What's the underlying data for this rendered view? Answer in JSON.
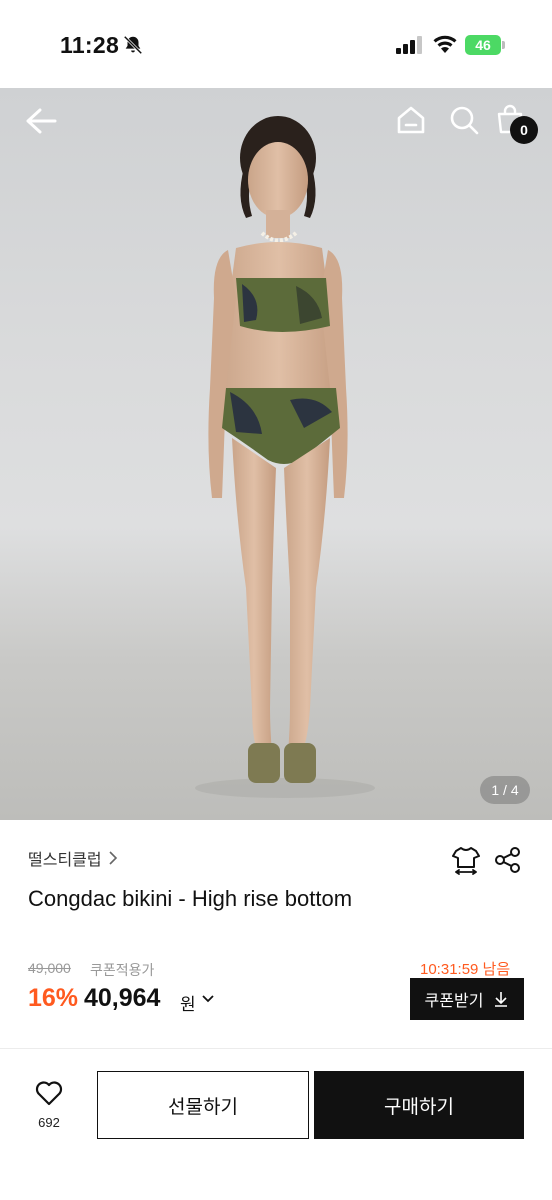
{
  "status_bar": {
    "time": "11:28",
    "battery": "46"
  },
  "header": {
    "cart_count": "0"
  },
  "gallery": {
    "counter": "1 / 4"
  },
  "product": {
    "brand": "떨스티클럽",
    "title": "Congdac bikini - High rise bottom",
    "original_price": "49,000",
    "coupon_label": "쿠폰적용가",
    "discount_rate": "16%",
    "sale_price": "40,964",
    "currency": "원",
    "countdown": "10:31:59 남음",
    "coupon_button": "쿠폰받기"
  },
  "bottom_bar": {
    "like_count": "692",
    "gift_button": "선물하기",
    "buy_button": "구매하기"
  },
  "colors": {
    "accent": "#ff5a1f",
    "dark": "#111111",
    "battery": "#4cd964"
  }
}
